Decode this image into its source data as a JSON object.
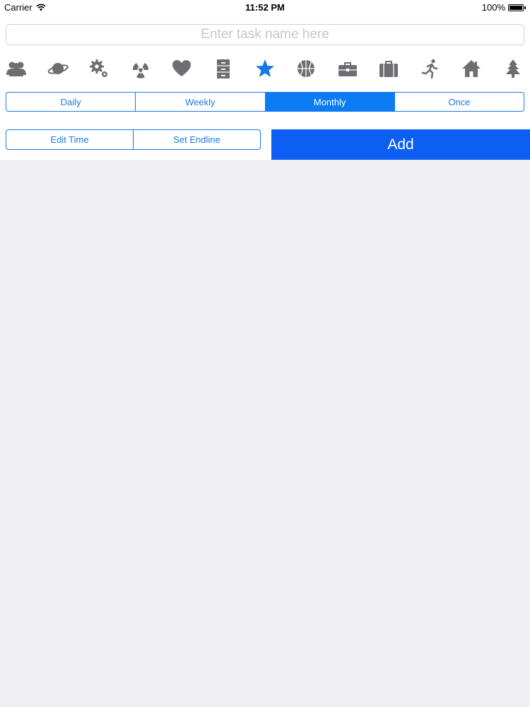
{
  "status_bar": {
    "carrier": "Carrier",
    "time": "11:52 PM",
    "battery": "100%"
  },
  "task_input": {
    "placeholder": "Enter task name here",
    "value": ""
  },
  "icons": [
    {
      "name": "people-icon",
      "selected": false
    },
    {
      "name": "planet-icon",
      "selected": false
    },
    {
      "name": "gears-icon",
      "selected": false
    },
    {
      "name": "radiation-icon",
      "selected": false
    },
    {
      "name": "heart-icon",
      "selected": false
    },
    {
      "name": "cabinet-icon",
      "selected": false
    },
    {
      "name": "star-icon",
      "selected": true
    },
    {
      "name": "basketball-icon",
      "selected": false
    },
    {
      "name": "toolbox-icon",
      "selected": false
    },
    {
      "name": "suitcase-icon",
      "selected": false
    },
    {
      "name": "runner-icon",
      "selected": false
    },
    {
      "name": "house-icon",
      "selected": false
    },
    {
      "name": "tree-icon",
      "selected": false
    }
  ],
  "frequency": {
    "options": [
      "Daily",
      "Weekly",
      "Monthly",
      "Once"
    ],
    "selected": "Monthly"
  },
  "time_buttons": {
    "edit_time": "Edit Time",
    "set_endline": "Set Endline"
  },
  "add_button": {
    "label": "Add"
  },
  "colors": {
    "accent": "#1a7ae6",
    "add_button": "#0d5ff3",
    "icon_gray": "#6e6e72",
    "icon_selected": "#1577e8",
    "background": "#efeff4"
  }
}
